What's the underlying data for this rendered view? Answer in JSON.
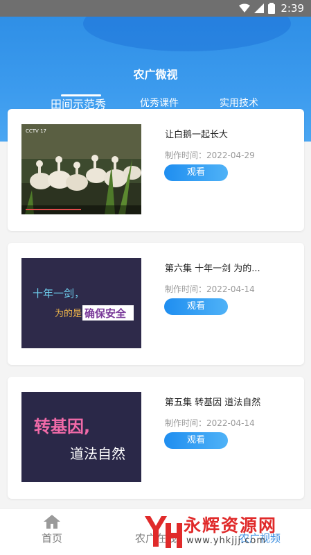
{
  "status_bar": {
    "time": "2:39"
  },
  "header": {
    "title": "农广微视"
  },
  "tabs": [
    {
      "label": "田间示范秀",
      "active": true
    },
    {
      "label": "优秀课件",
      "active": false
    },
    {
      "label": "实用技术",
      "active": false
    }
  ],
  "videos": [
    {
      "title": "让白鹅一起长大",
      "date": "制作时间：2022-04-29",
      "button": "观看",
      "thumb_logo": "CCTV 17",
      "thumb_caption": ""
    },
    {
      "title": "第六集 十年一剑 为的...",
      "date": "制作时间：2022-04-14",
      "button": "观看",
      "thumb_caption": "十年一剑，为的是确保安全"
    },
    {
      "title": "第五集 转基因 道法自然",
      "date": "制作时间：2022-04-14",
      "button": "观看",
      "thumb_caption": "转基因，道法自然"
    }
  ],
  "bottom_nav": [
    {
      "label": "首页",
      "icon": "home-icon"
    },
    {
      "label": "农广在线",
      "icon": ""
    },
    {
      "label": "农广视频",
      "icon": ""
    }
  ],
  "watermark": {
    "text": "永辉资源网",
    "url": "www.yhkjjj.com"
  },
  "colors": {
    "primary": "#2f8fe6",
    "button": "#1f8ef0",
    "watermark": "#e02a2a"
  }
}
